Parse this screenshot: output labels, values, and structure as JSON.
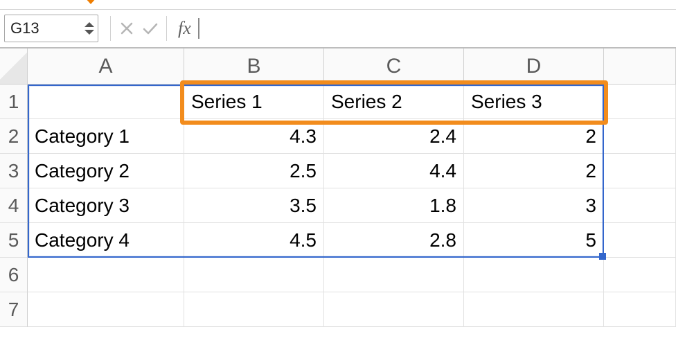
{
  "namebox": {
    "value": "G13"
  },
  "fx_label": "fx",
  "formula": "",
  "columns": [
    "A",
    "B",
    "C",
    "D"
  ],
  "rows": [
    "1",
    "2",
    "3",
    "4",
    "5",
    "6",
    "7"
  ],
  "grid": {
    "r1": {
      "A": "",
      "B": "Series 1",
      "C": "Series 2",
      "D": "Series 3"
    },
    "r2": {
      "A": "Category 1",
      "B": "4.3",
      "C": "2.4",
      "D": "2"
    },
    "r3": {
      "A": "Category 2",
      "B": "2.5",
      "C": "4.4",
      "D": "2"
    },
    "r4": {
      "A": "Category 3",
      "B": "3.5",
      "C": "1.8",
      "D": "3"
    },
    "r5": {
      "A": "Category 4",
      "B": "4.5",
      "C": "2.8",
      "D": "5"
    },
    "r6": {
      "A": "",
      "B": "",
      "C": "",
      "D": ""
    },
    "r7": {
      "A": "",
      "B": "",
      "C": "",
      "D": ""
    }
  },
  "chart_data": {
    "type": "table",
    "categories": [
      "Category 1",
      "Category 2",
      "Category 3",
      "Category 4"
    ],
    "series": [
      {
        "name": "Series 1",
        "values": [
          4.3,
          2.5,
          3.5,
          4.5
        ]
      },
      {
        "name": "Series 2",
        "values": [
          2.4,
          4.4,
          1.8,
          2.8
        ]
      },
      {
        "name": "Series 3",
        "values": [
          2,
          2,
          3,
          5
        ]
      }
    ]
  }
}
